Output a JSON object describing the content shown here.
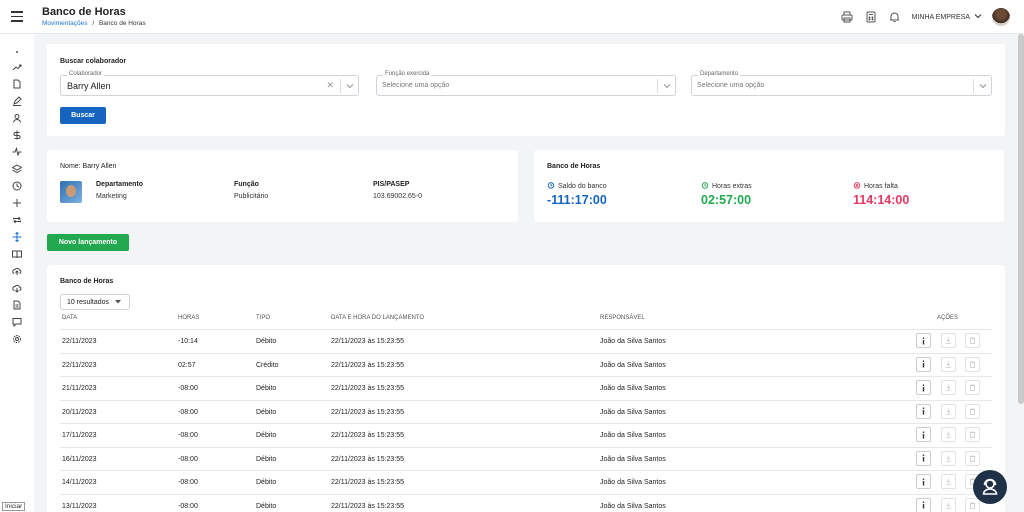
{
  "header": {
    "title": "Banco de Horas",
    "breadcrumb": {
      "parent": "Movimentações",
      "separator": "/",
      "current": "Banco de Horas"
    },
    "company": "MINHA EMPRESA"
  },
  "search": {
    "title": "Buscar colaborador",
    "colaborador_label": "Colaborador",
    "colaborador_value": "Barry Allen",
    "funcao_label": "Função exercida",
    "funcao_placeholder": "Selecione uma opção",
    "departamento_label": "Departamento",
    "departamento_placeholder": "Selecione uma opção",
    "button": "Buscar"
  },
  "employee": {
    "name_line": "Nome: Barry Allen",
    "departamento_label": "Departamento",
    "departamento_value": "Marketing",
    "funcao_label": "Função",
    "funcao_value": "Publicitário",
    "pis_label": "PIS/PASEP",
    "pis_value": "103.69002.65-0"
  },
  "bank": {
    "title": "Banco de Horas",
    "saldo_label": "Saldo do banco",
    "saldo_value": "-111:17:00",
    "extras_label": "Horas extras",
    "extras_value": "02:57:00",
    "falta_label": "Horas falta",
    "falta_value": "114:14:00",
    "colors": {
      "saldo": "#1565c0",
      "extras": "#22a94f",
      "falta": "#e53960"
    }
  },
  "new_button": "Novo lançamento",
  "table": {
    "title": "Banco de Horas",
    "results": "10 resultados",
    "headers": [
      "DATA",
      "HORAS",
      "TIPO",
      "DATA E HORA DO LANÇAMENTO",
      "RESPONSÁVEL",
      "AÇÕES"
    ],
    "rows": [
      [
        "22/11/2023",
        "-10:14",
        "Débito",
        "22/11/2023 às 15:23:55",
        "João da Silva Santos"
      ],
      [
        "22/11/2023",
        "02:57",
        "Crédito",
        "22/11/2023 às 15:23:55",
        "João da Silva Santos"
      ],
      [
        "21/11/2023",
        "-08:00",
        "Débito",
        "22/11/2023 às 15:23:55",
        "João da Silva Santos"
      ],
      [
        "20/11/2023",
        "-08:00",
        "Débito",
        "22/11/2023 às 15:23:55",
        "João da Silva Santos"
      ],
      [
        "17/11/2023",
        "-08:00",
        "Débito",
        "22/11/2023 às 15:23:55",
        "João da Silva Santos"
      ],
      [
        "16/11/2023",
        "-08:00",
        "Débito",
        "22/11/2023 às 15:23:55",
        "João da Silva Santos"
      ],
      [
        "14/11/2023",
        "-08:00",
        "Débito",
        "22/11/2023 às 15:23:55",
        "João da Silva Santos"
      ],
      [
        "13/11/2023",
        "-08:00",
        "Débito",
        "22/11/2023 às 15:23:55",
        "João da Silva Santos"
      ]
    ]
  },
  "taskbar": {
    "start": "Iniciar"
  }
}
